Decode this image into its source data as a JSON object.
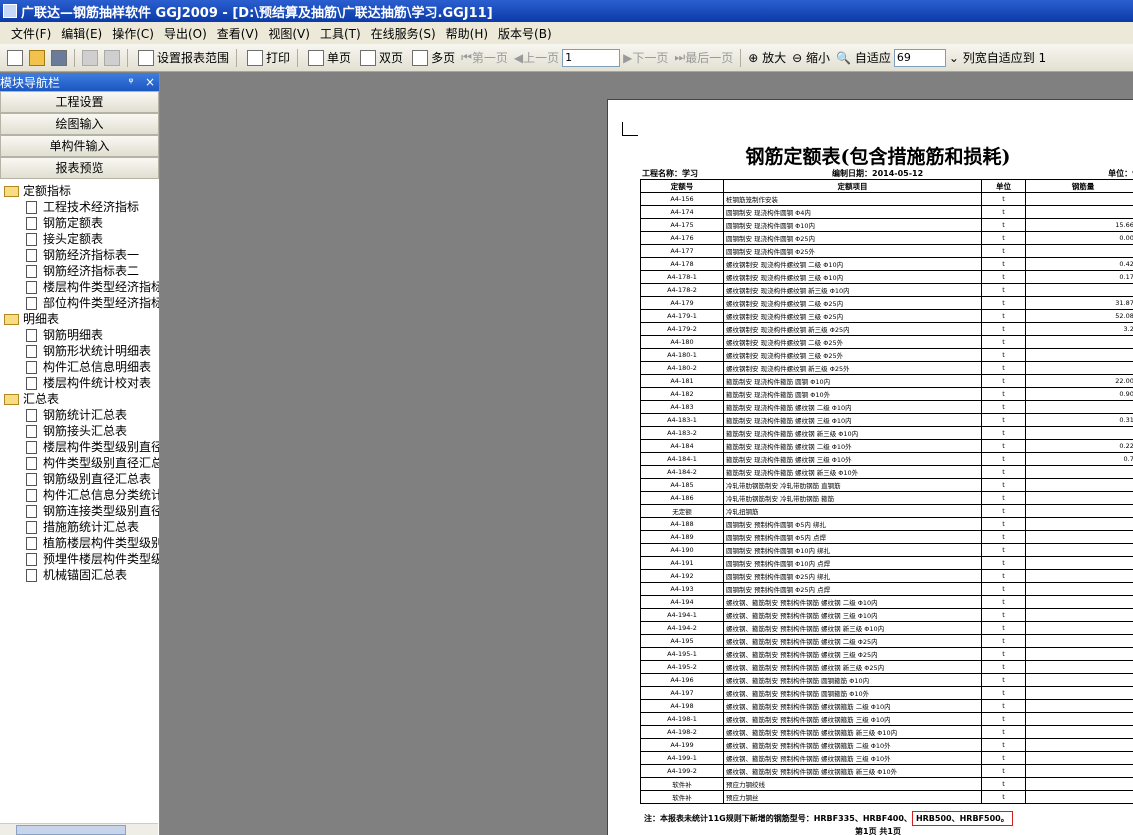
{
  "window": {
    "title": "广联达—钢筋抽样软件 GGJ2009 - [D:\\预结算及抽筋\\广联达抽筋\\学习.GGJ11]"
  },
  "menu": [
    "文件(F)",
    "编辑(E)",
    "操作(C)",
    "导出(O)",
    "查看(V)",
    "视图(V)",
    "工具(T)",
    "在线服务(S)",
    "帮助(H)",
    "版本号(B)"
  ],
  "toolbar": {
    "set_range": "设置报表范围",
    "print": "打印",
    "single_page": "单页",
    "double_page": "双页",
    "multi_page": "多页",
    "first_page": "第一页",
    "prev_page": "上一页",
    "page_value": "1",
    "next_page": "下一页",
    "last_page": "最后一页",
    "zoom_in": "放大",
    "zoom_out": "缩小",
    "fit": "自适应",
    "zoom_value": "69",
    "col_fit": "列宽自适应到 1"
  },
  "nav": {
    "title": "模块导航栏",
    "pin": "ᵠ",
    "close": "×",
    "buttons": [
      "工程设置",
      "绘图输入",
      "单构件输入",
      "报表预览"
    ],
    "groups": [
      {
        "label": "定额指标",
        "items": [
          "工程技术经济指标",
          "钢筋定额表",
          "接头定额表",
          "钢筋经济指标表一",
          "钢筋经济指标表二",
          "楼层构件类型经济指标",
          "部位构件类型经济指标"
        ]
      },
      {
        "label": "明细表",
        "items": [
          "钢筋明细表",
          "钢筋形状统计明细表",
          "构件汇总信息明细表",
          "楼层构件统计校对表"
        ]
      },
      {
        "label": "汇总表",
        "items": [
          "钢筋统计汇总表",
          "钢筋接头汇总表",
          "楼层构件类型级别直径",
          "构件类型级别直径汇总",
          "钢筋级别直径汇总表",
          "构件汇总信息分类统计",
          "钢筋连接类型级别直径",
          "措施筋统计汇总表",
          "植筋楼层构件类型级别",
          "预埋件楼层构件类型级",
          "机械锚固汇总表"
        ]
      }
    ]
  },
  "report": {
    "title": "钢筋定额表(包含措施筋和损耗)",
    "project_label": "工程名称：学习",
    "date_label": "编制日期：2014-05-12",
    "unit_label": "单位：t",
    "headers": [
      "定额号",
      "定额项目",
      "单位",
      "钢筋量"
    ],
    "rows": [
      [
        "A4-156",
        "桩钢筋笼制作安装",
        "t",
        ""
      ],
      [
        "A4-174",
        "圆钢制安 现浇构件圆钢 Φ4内",
        "t",
        ""
      ],
      [
        "A4-175",
        "圆钢制安 现浇构件圆钢 Φ10内",
        "t",
        "15.669"
      ],
      [
        "A4-176",
        "圆钢制安 现浇构件圆钢 Φ25内",
        "t",
        "0.008"
      ],
      [
        "A4-177",
        "圆钢制安 现浇构件圆钢 Φ25外",
        "t",
        ""
      ],
      [
        "A4-178",
        "螺纹钢制安 现浇构件螺纹钢 二级 Φ10内",
        "t",
        "0.425"
      ],
      [
        "A4-178-1",
        "螺纹钢制安 现浇构件螺纹钢 三级 Φ10内",
        "t",
        "0.171"
      ],
      [
        "A4-178-2",
        "螺纹钢制安 现浇构件螺纹钢 新三级 Φ10内",
        "t",
        ""
      ],
      [
        "A4-179",
        "螺纹钢制安 现浇构件螺纹钢 二级 Φ25内",
        "t",
        "31.874"
      ],
      [
        "A4-179-1",
        "螺纹钢制安 现浇构件螺纹钢 三级 Φ25内",
        "t",
        "52.084"
      ],
      [
        "A4-179-2",
        "螺纹钢制安 现浇构件螺纹钢 新三级 Φ25内",
        "t",
        "3.26"
      ],
      [
        "A4-180",
        "螺纹钢制安 现浇构件螺纹钢 二级 Φ25外",
        "t",
        ""
      ],
      [
        "A4-180-1",
        "螺纹钢制安 现浇构件螺纹钢 三级 Φ25外",
        "t",
        ""
      ],
      [
        "A4-180-2",
        "螺纹钢制安 现浇构件螺纹钢 新三级 Φ25外",
        "t",
        ""
      ],
      [
        "A4-181",
        "箍筋制安 现浇构件箍筋 圆钢 Φ10内",
        "t",
        "22.001"
      ],
      [
        "A4-182",
        "箍筋制安 现浇构件箍筋 圆钢 Φ10外",
        "t",
        "0.905"
      ],
      [
        "A4-183",
        "箍筋制安 现浇构件箍筋 螺纹钢 二级 Φ10内",
        "t",
        ""
      ],
      [
        "A4-183-1",
        "箍筋制安 现浇构件箍筋 螺纹钢 三级 Φ10内",
        "t",
        "0.311"
      ],
      [
        "A4-183-2",
        "箍筋制安 现浇构件箍筋 螺纹钢 新三级 Φ10内",
        "t",
        ""
      ],
      [
        "A4-184",
        "箍筋制安 现浇构件箍筋 螺纹钢 二级 Φ10外",
        "t",
        "0.225"
      ],
      [
        "A4-184-1",
        "箍筋制安 现浇构件箍筋 螺纹钢 三级 Φ10外",
        "t",
        "0.76"
      ],
      [
        "A4-184-2",
        "箍筋制安 现浇构件箍筋 螺纹钢 新三级 Φ10外",
        "t",
        ""
      ],
      [
        "A4-185",
        "冷轧带肋钢筋制安 冷轧带肋钢筋 直钢筋",
        "t",
        ""
      ],
      [
        "A4-186",
        "冷轧带肋钢筋制安 冷轧带肋钢筋 箍筋",
        "t",
        ""
      ],
      [
        "无定额",
        "冷轧扭钢筋",
        "t",
        ""
      ],
      [
        "A4-188",
        "圆钢制安 预制构件圆钢 Φ5内 绑扎",
        "t",
        ""
      ],
      [
        "A4-189",
        "圆钢制安 预制构件圆钢 Φ5内 点焊",
        "t",
        ""
      ],
      [
        "A4-190",
        "圆钢制安 预制构件圆钢 Φ10内 绑扎",
        "t",
        ""
      ],
      [
        "A4-191",
        "圆钢制安 预制构件圆钢 Φ10内 点焊",
        "t",
        ""
      ],
      [
        "A4-192",
        "圆钢制安 预制构件圆钢 Φ25内 绑扎",
        "t",
        ""
      ],
      [
        "A4-193",
        "圆钢制安 预制构件圆钢 Φ25内 点焊",
        "t",
        ""
      ],
      [
        "A4-194",
        "螺纹钢、箍筋制安 预制构件钢筋 螺纹钢 二级 Φ10内",
        "t",
        ""
      ],
      [
        "A4-194-1",
        "螺纹钢、箍筋制安 预制构件钢筋 螺纹钢 三级 Φ10内",
        "t",
        ""
      ],
      [
        "A4-194-2",
        "螺纹钢、箍筋制安 预制构件钢筋 螺纹钢 新三级 Φ10内",
        "t",
        ""
      ],
      [
        "A4-195",
        "螺纹钢、箍筋制安 预制构件钢筋 螺纹钢 二级 Φ25内",
        "t",
        ""
      ],
      [
        "A4-195-1",
        "螺纹钢、箍筋制安 预制构件钢筋 螺纹钢 三级 Φ25内",
        "t",
        ""
      ],
      [
        "A4-195-2",
        "螺纹钢、箍筋制安 预制构件钢筋 螺纹钢 新三级 Φ25内",
        "t",
        ""
      ],
      [
        "A4-196",
        "螺纹钢、箍筋制安 预制构件钢筋 圆钢箍筋 Φ10内",
        "t",
        ""
      ],
      [
        "A4-197",
        "螺纹钢、箍筋制安 预制构件钢筋 圆钢箍筋 Φ10外",
        "t",
        ""
      ],
      [
        "A4-198",
        "螺纹钢、箍筋制安 预制构件钢筋 螺纹钢箍筋 二级 Φ10内",
        "t",
        ""
      ],
      [
        "A4-198-1",
        "螺纹钢、箍筋制安 预制构件钢筋 螺纹钢箍筋 三级 Φ10内",
        "t",
        ""
      ],
      [
        "A4-198-2",
        "螺纹钢、箍筋制安 预制构件钢筋 螺纹钢箍筋 新三级 Φ10内",
        "t",
        ""
      ],
      [
        "A4-199",
        "螺纹钢、箍筋制安 预制构件钢筋 螺纹钢箍筋 二级 Φ10外",
        "t",
        ""
      ],
      [
        "A4-199-1",
        "螺纹钢、箍筋制安 预制构件钢筋 螺纹钢箍筋 三级 Φ10外",
        "t",
        ""
      ],
      [
        "A4-199-2",
        "螺纹钢、箍筋制安 预制构件钢筋 螺纹钢箍筋 新三级 Φ10外",
        "t",
        ""
      ],
      [
        "软件补",
        "预应力钢绞线",
        "t",
        ""
      ],
      [
        "软件补",
        "预应力钢丝",
        "t",
        ""
      ]
    ],
    "note_prefix": "注：本报表未统计11G规则下新增的钢筋型号：HRBF335、HRBF400、",
    "note_highlight": "HRB500、HRBF500。",
    "page_footer": "第1页 共1页"
  },
  "colors": {
    "title_bar": "#0a3aa8",
    "highlight_box": "#d02020"
  }
}
